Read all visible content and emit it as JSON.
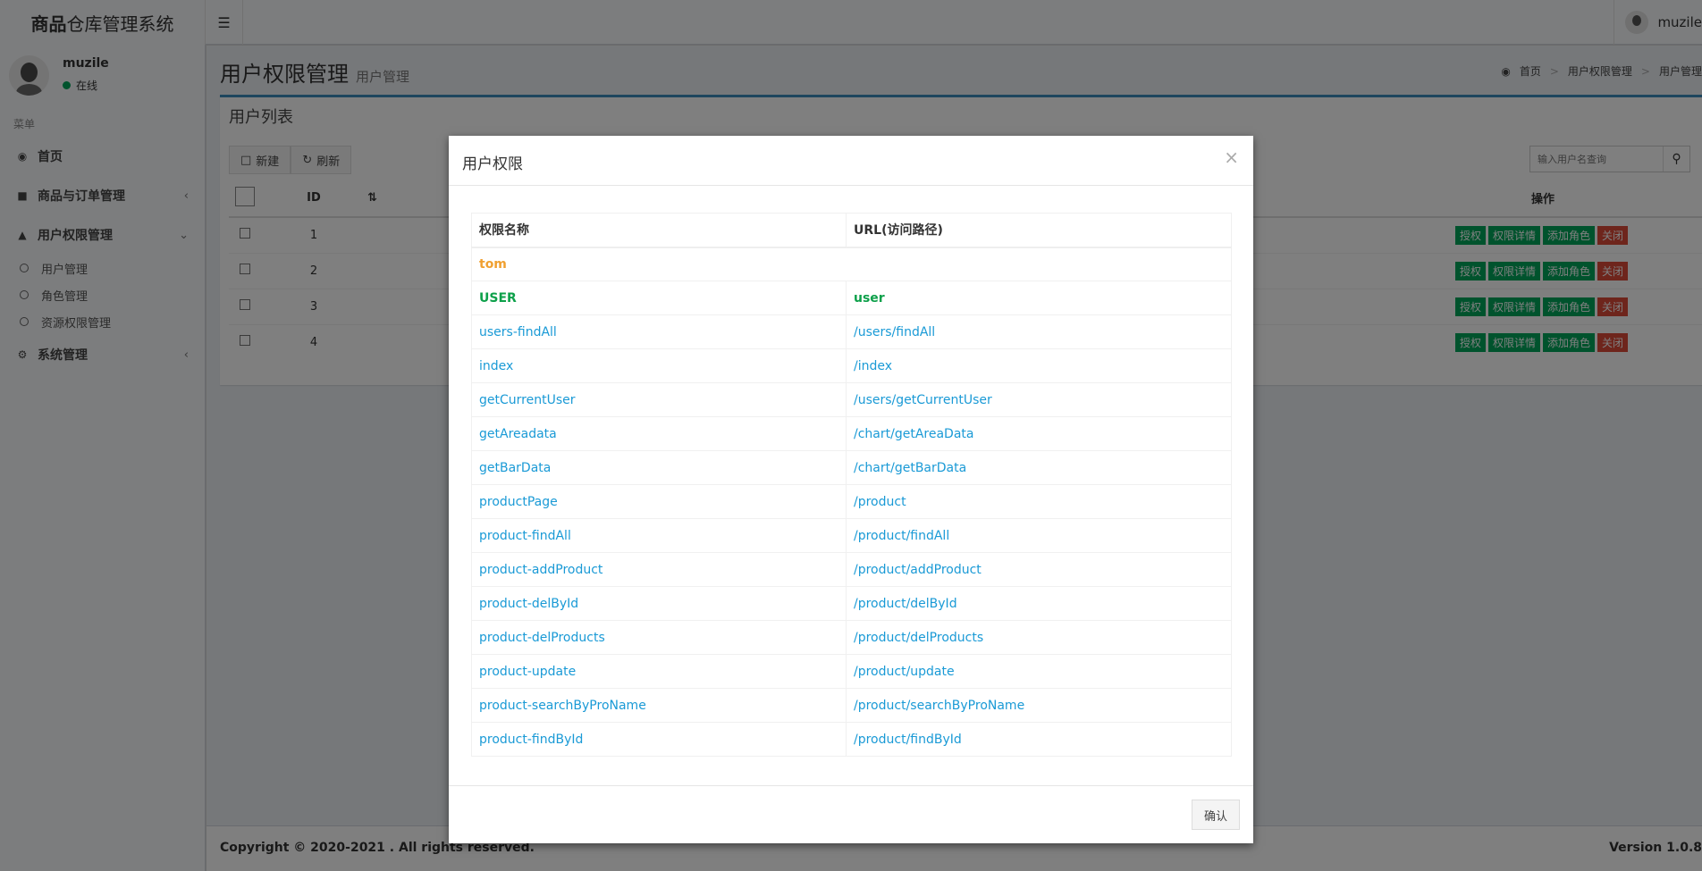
{
  "app": {
    "title_bold": "商品",
    "title_rest": "仓库管理系统"
  },
  "topbar": {
    "user_name": "muzile",
    "menu_toggle_icon": "bars-icon"
  },
  "sidebar": {
    "user": {
      "name": "muzile",
      "status": "在线",
      "status_color": "#00a65a"
    },
    "menu_header": "菜单",
    "items": [
      {
        "label": "首页",
        "icon": "dashboard-icon"
      },
      {
        "label": "商品与订单管理",
        "icon": "folder-icon"
      },
      {
        "label": "用户权限管理",
        "icon": "lock-icon",
        "expanded": true,
        "children": [
          {
            "label": "用户管理"
          },
          {
            "label": "角色管理"
          },
          {
            "label": "资源权限管理"
          }
        ]
      },
      {
        "label": "系统管理",
        "icon": "cogs-icon"
      }
    ]
  },
  "page": {
    "title": "用户权限管理",
    "subtitle": "用户管理",
    "breadcrumb": [
      "首页",
      "用户权限管理",
      "用户管理"
    ]
  },
  "box": {
    "title": "用户列表",
    "new_label": "新建",
    "refresh_label": "刷新",
    "search_placeholder": "输入用户名查询",
    "columns": {
      "id": "ID",
      "actions": "操作"
    },
    "rows": [
      {
        "id": "1"
      },
      {
        "id": "2"
      },
      {
        "id": "3"
      },
      {
        "id": "4"
      }
    ],
    "row_actions": [
      "授权",
      "权限详情",
      "添加角色",
      "关闭"
    ]
  },
  "footer": {
    "copyright": "Copyright © 2020-2021 . All rights reserved.",
    "version": "Version 1.0.8"
  },
  "modal": {
    "title": "用户权限",
    "close_icon": "×",
    "columns": {
      "name": "权限名称",
      "url": "URL(访问路径)"
    },
    "user": "tom",
    "role": {
      "name": "USER",
      "url": "user"
    },
    "permissions": [
      {
        "name": "users-findAll",
        "url": "/users/findAll"
      },
      {
        "name": "index",
        "url": "/index"
      },
      {
        "name": "getCurrentUser",
        "url": "/users/getCurrentUser"
      },
      {
        "name": "getAreadata",
        "url": "/chart/getAreaData"
      },
      {
        "name": "getBarData",
        "url": "/chart/getBarData"
      },
      {
        "name": "productPage",
        "url": "/product"
      },
      {
        "name": "product-findAll",
        "url": "/product/findAll"
      },
      {
        "name": "product-addProduct",
        "url": "/product/addProduct"
      },
      {
        "name": "product-delById",
        "url": "/product/delById"
      },
      {
        "name": "product-delProducts",
        "url": "/product/delProducts"
      },
      {
        "name": "product-update",
        "url": "/product/update"
      },
      {
        "name": "product-searchByProName",
        "url": "/product/searchByProName"
      },
      {
        "name": "product-findById",
        "url": "/product/findById"
      }
    ],
    "confirm_label": "确认"
  },
  "colors": {
    "accent": "#3c8dbc",
    "success": "#00a65a",
    "danger": "#dd4b39",
    "link": "#1a9ad6",
    "user_highlight": "#f0a030"
  }
}
